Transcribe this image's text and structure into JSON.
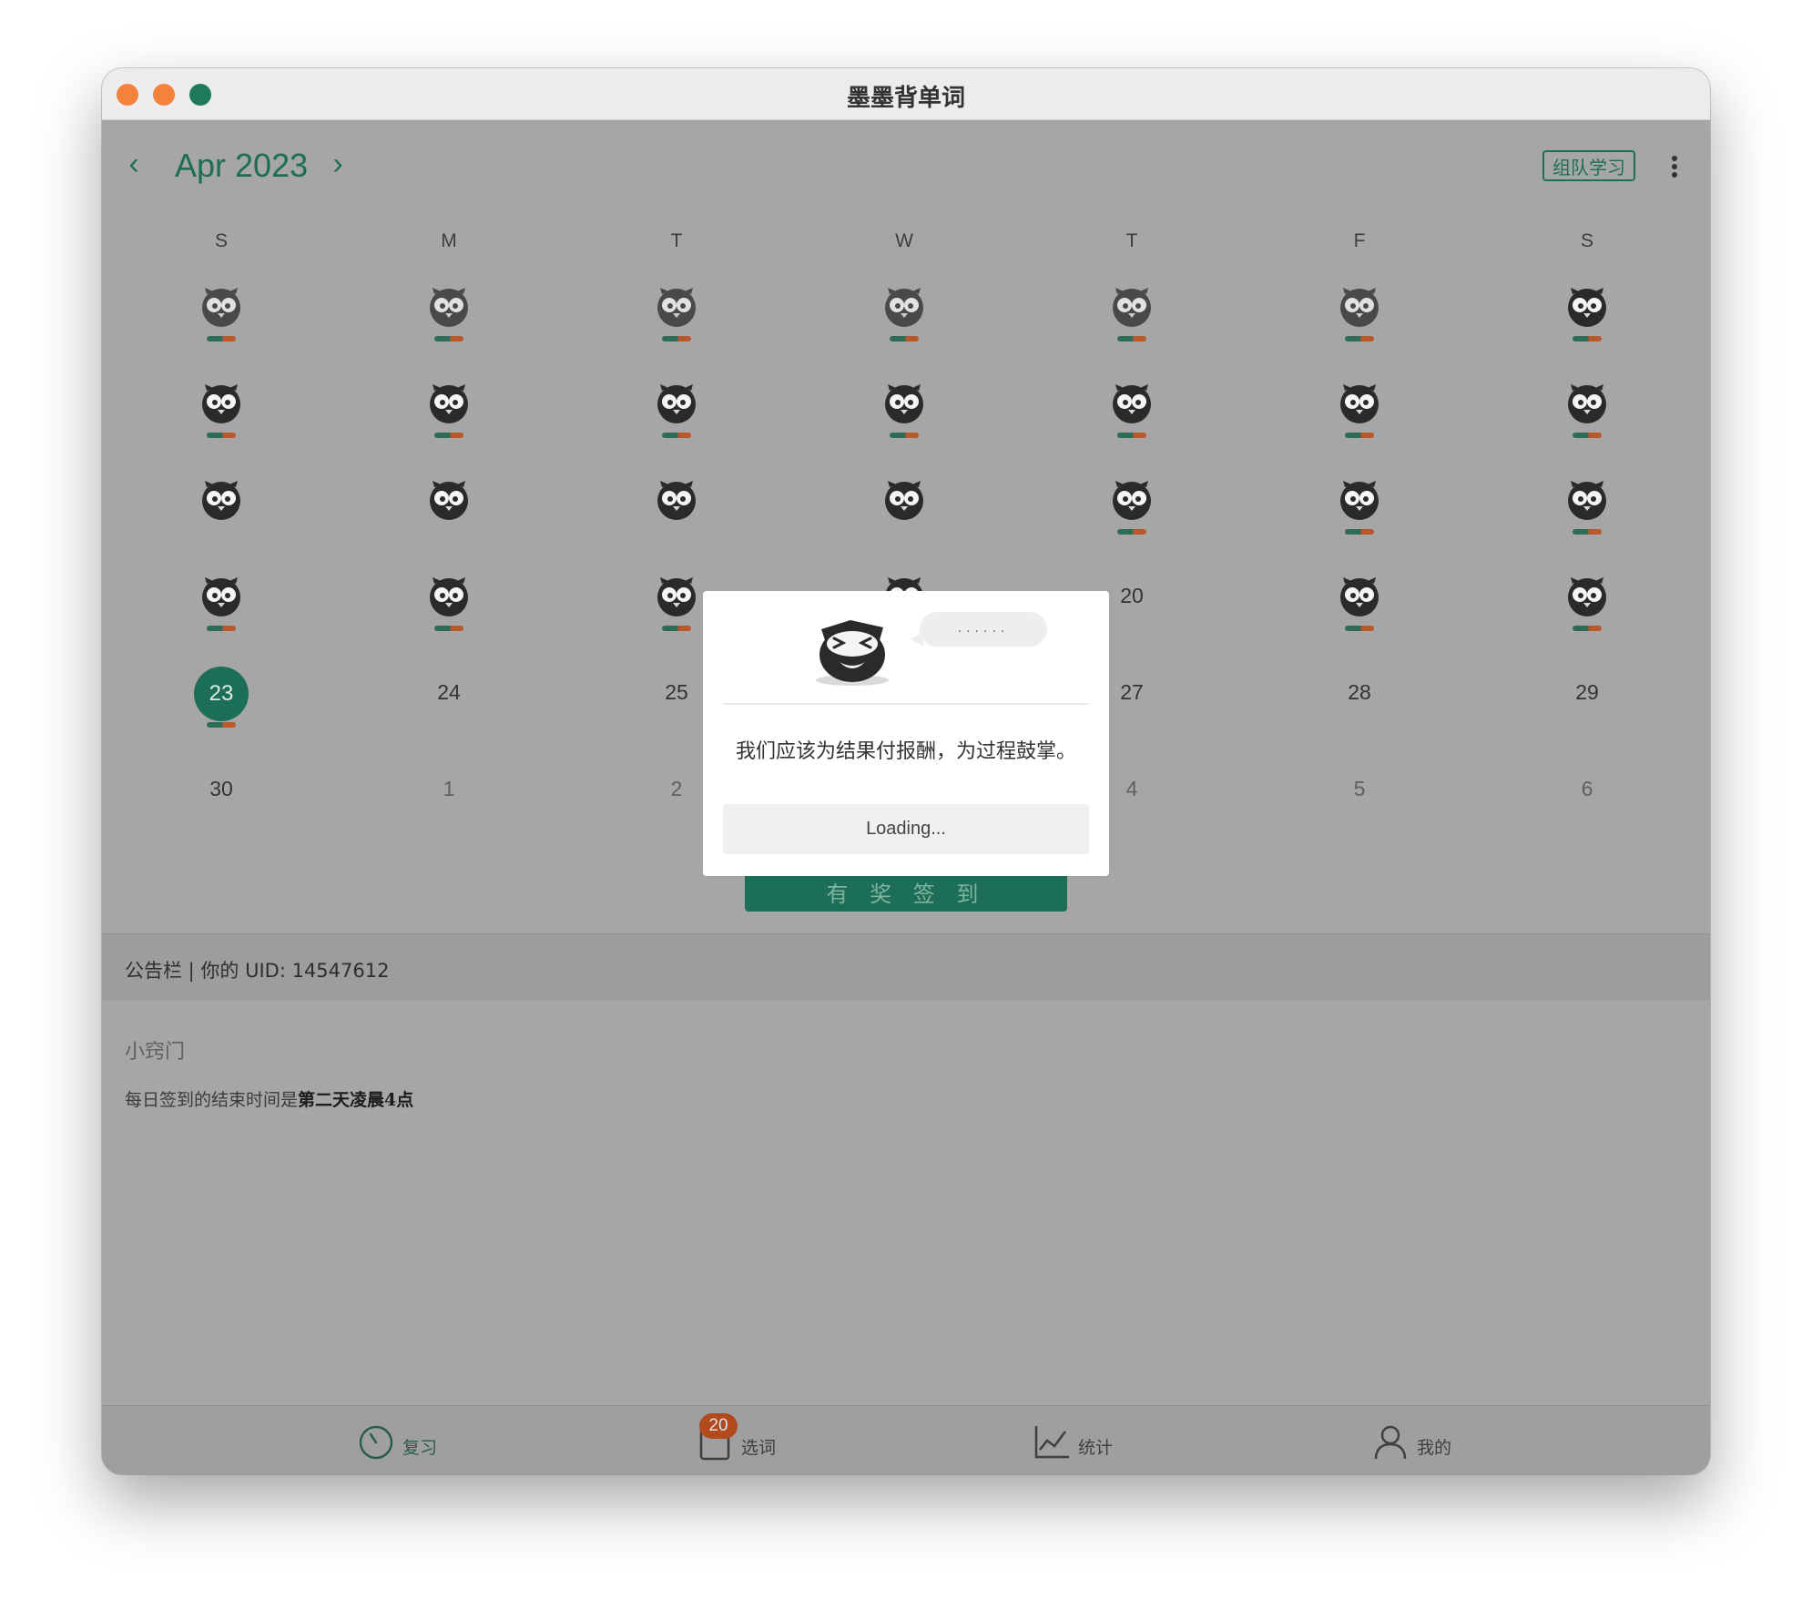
{
  "window": {
    "title": "墨墨背单词"
  },
  "header": {
    "month_label": "Apr 2023",
    "team_button": "组队学习"
  },
  "calendar": {
    "weekdays": [
      "S",
      "M",
      "T",
      "W",
      "T",
      "F",
      "S"
    ],
    "days": [
      "20",
      "23",
      "24",
      "25",
      "27",
      "28",
      "29",
      "30",
      "1",
      "2",
      "4",
      "5",
      "6"
    ],
    "today": "23"
  },
  "checkin_button": "有 奖 签 到",
  "notice": {
    "title": "公告栏 | 你的 UID: 14547612",
    "tip_heading": "小窍门",
    "tip_body_prefix": "每日签到的结束时间是",
    "tip_body_bold": "第二天凌晨4点"
  },
  "tabs": [
    {
      "label": "复习",
      "icon": "timer-icon"
    },
    {
      "label": "选词",
      "icon": "clipboard-icon",
      "badge": "20"
    },
    {
      "label": "统计",
      "icon": "chart-icon"
    },
    {
      "label": "我的",
      "icon": "person-icon"
    }
  ],
  "dialog": {
    "speech": "......",
    "quote": "我们应该为结果付报酬，为过程鼓掌。",
    "loading": "Loading..."
  },
  "colors": {
    "accent": "#1d6e56",
    "badge": "#b24a1e",
    "overlay": "#a6a6a6"
  }
}
